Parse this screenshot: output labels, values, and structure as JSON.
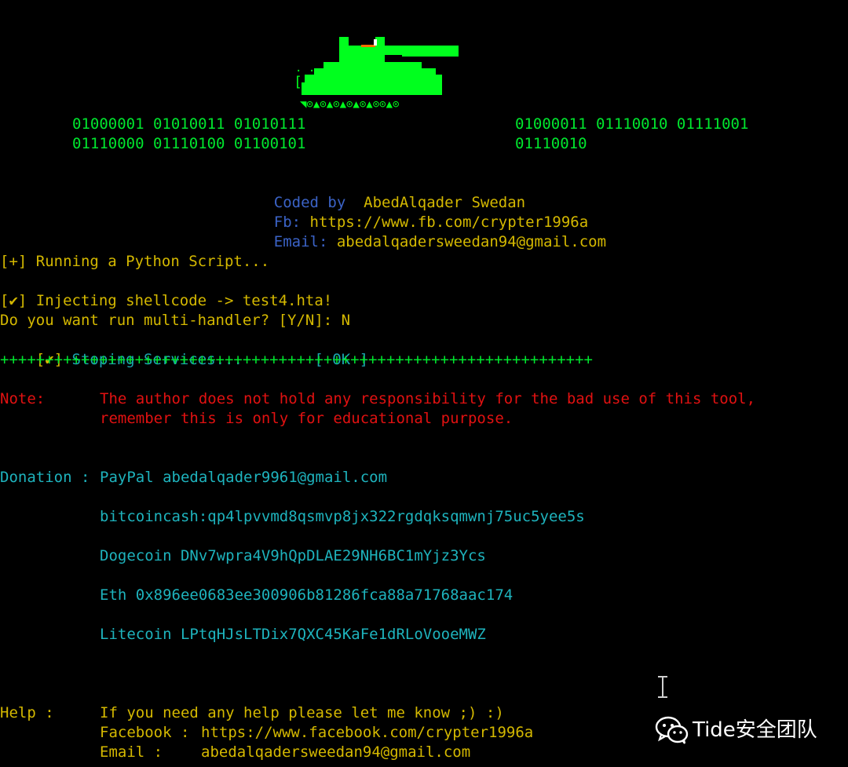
{
  "binary": {
    "left_line1": "01000001 01010011 01010111",
    "left_line2": "01110000 01110100 01100101",
    "right_line1": "01000011 01110010 01111001",
    "right_line2": "01110010"
  },
  "credits": {
    "coded_by_label": "Coded by",
    "coded_by_value": "AbedAlqader Swedan",
    "fb_label": "Fb:",
    "fb_value": "https://www.fb.com/crypter1996a",
    "email_label": "Email:",
    "email_value": "abedalqadersweedan94@gmail.com"
  },
  "log": {
    "running": "[+] Running a Python Script...",
    "injecting": "[✔] Injecting shellcode -> test4.hta!",
    "prompt": "Do you want run multi-handler? [Y/N]: N",
    "stopping_prefix": "[✔]",
    "stopping_text": "Stoping Services...",
    "stopping_status": "[ OK ]",
    "separator": "++++++++++++++++++++++++++++++++++++++++++++++++++++++++++++++++++"
  },
  "note": {
    "label": "Note:",
    "line1": "The author does not hold any responsibility for the bad use of this tool,",
    "line2": "remember this is only for educational purpose."
  },
  "donation": {
    "label": "Donation :",
    "paypal": "PayPal abedalqader9961@gmail.com",
    "bitcoincash": "bitcoincash:qp4lpvvmd8qsmvp8jx322rgdqksqmwnj75uc5yee5s",
    "dogecoin": "Dogecoin DNv7wpra4V9hQpDLAE29NH6BC1mYjz3Ycs",
    "eth": "Eth 0x896ee0683ee300906b81286fca88a71768aac174",
    "litecoin": "Litecoin LPtqHJsLTDix7QXC45KaFe1dRLoVooeMWZ"
  },
  "help": {
    "label": "Help :",
    "line1": "If you need any help please let me know ;) :)",
    "facebook_label": "Facebook :",
    "facebook_value": "https://www.facebook.com/crypter1996a",
    "email_label": "Email :",
    "email_value": "abedalqadersweedan94@gmail.com"
  },
  "watermark": {
    "text": "Tide安全团队"
  },
  "colors": {
    "background": "#000000",
    "green": "#00e62e",
    "yellow": "#d4b800",
    "red": "#e11111",
    "cyan": "#1ba5b0",
    "blue": "#3b63c7"
  },
  "icons": {
    "tank": "tank-ascii-art-icon",
    "cursor": "text-cursor-icon",
    "wechat": "wechat-icon"
  }
}
